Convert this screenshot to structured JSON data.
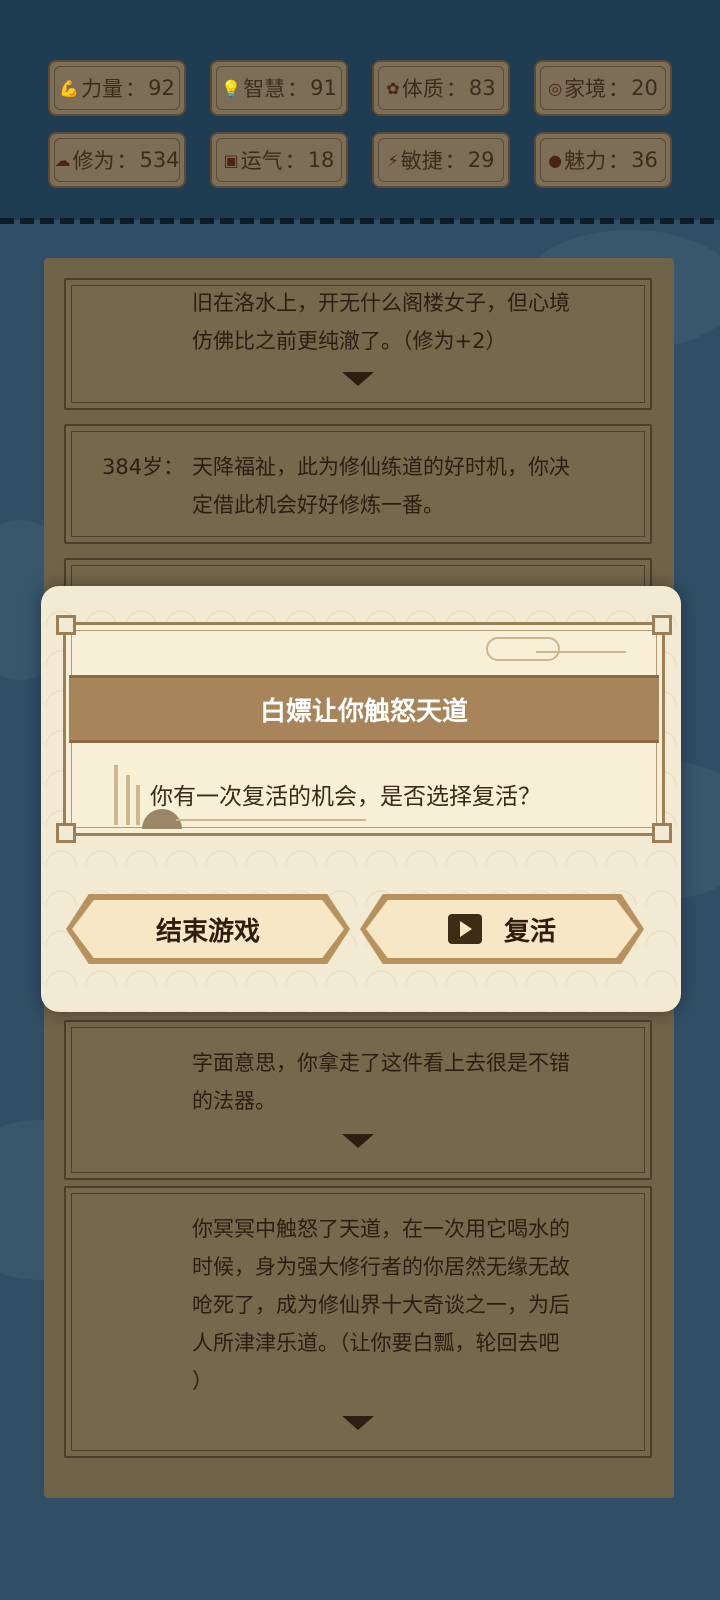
{
  "stats": [
    {
      "icon": "arm-icon",
      "glyph": "💪",
      "label": "力量",
      "value": "92"
    },
    {
      "icon": "bulb-icon",
      "glyph": "💡",
      "label": "智慧",
      "value": "91"
    },
    {
      "icon": "flower-icon",
      "glyph": "✿",
      "label": "体质",
      "value": "83"
    },
    {
      "icon": "wallet-icon",
      "glyph": "◎",
      "label": "家境",
      "value": "20"
    },
    {
      "icon": "cloud-icon",
      "glyph": "☁",
      "label": "修为",
      "value": "534"
    },
    {
      "icon": "luck-icon",
      "glyph": "▣",
      "label": "运气",
      "value": "18"
    },
    {
      "icon": "lightning-icon",
      "glyph": "⚡",
      "label": "敏捷",
      "value": "29"
    },
    {
      "icon": "charm-icon",
      "glyph": "●",
      "label": "魅力",
      "value": "36"
    }
  ],
  "stat_separator": "：",
  "log": {
    "card1": {
      "age": "",
      "lines": [
        "旧在洛水上，开无什么阁楼女子，但心境",
        "仿佛比之前更纯澈了。（修为+2）"
      ]
    },
    "card2": {
      "age": "384岁：",
      "lines": [
        "天降福祉，此为修仙练道的好时机，你决",
        "定借此机会好好修炼一番。"
      ]
    },
    "card3": {
      "age": "",
      "lines": [
        "字面意思，你拿走了这件看上去很是不错",
        "的法器。"
      ]
    },
    "card4": {
      "age": "",
      "lines": [
        "你冥冥中触怒了天道，在一次用它喝水的",
        "时候，身为强大修行者的你居然无缘无故",
        "呛死了，成为修仙界十大奇谈之一，为后",
        "人所津津乐道。（让你要白瓢，轮回去吧",
        "）"
      ]
    }
  },
  "dialog": {
    "title": "白嫖让你触怒天道",
    "message": "你有一次复活的机会，是否选择复活？",
    "end_button": "结束游戏",
    "revive_button": "复活"
  },
  "colors": {
    "background": "#2f4f66",
    "dialog_bg": "#f3ead4",
    "title_bar": "#a8845a",
    "button_bg": "#f6e8c7"
  }
}
